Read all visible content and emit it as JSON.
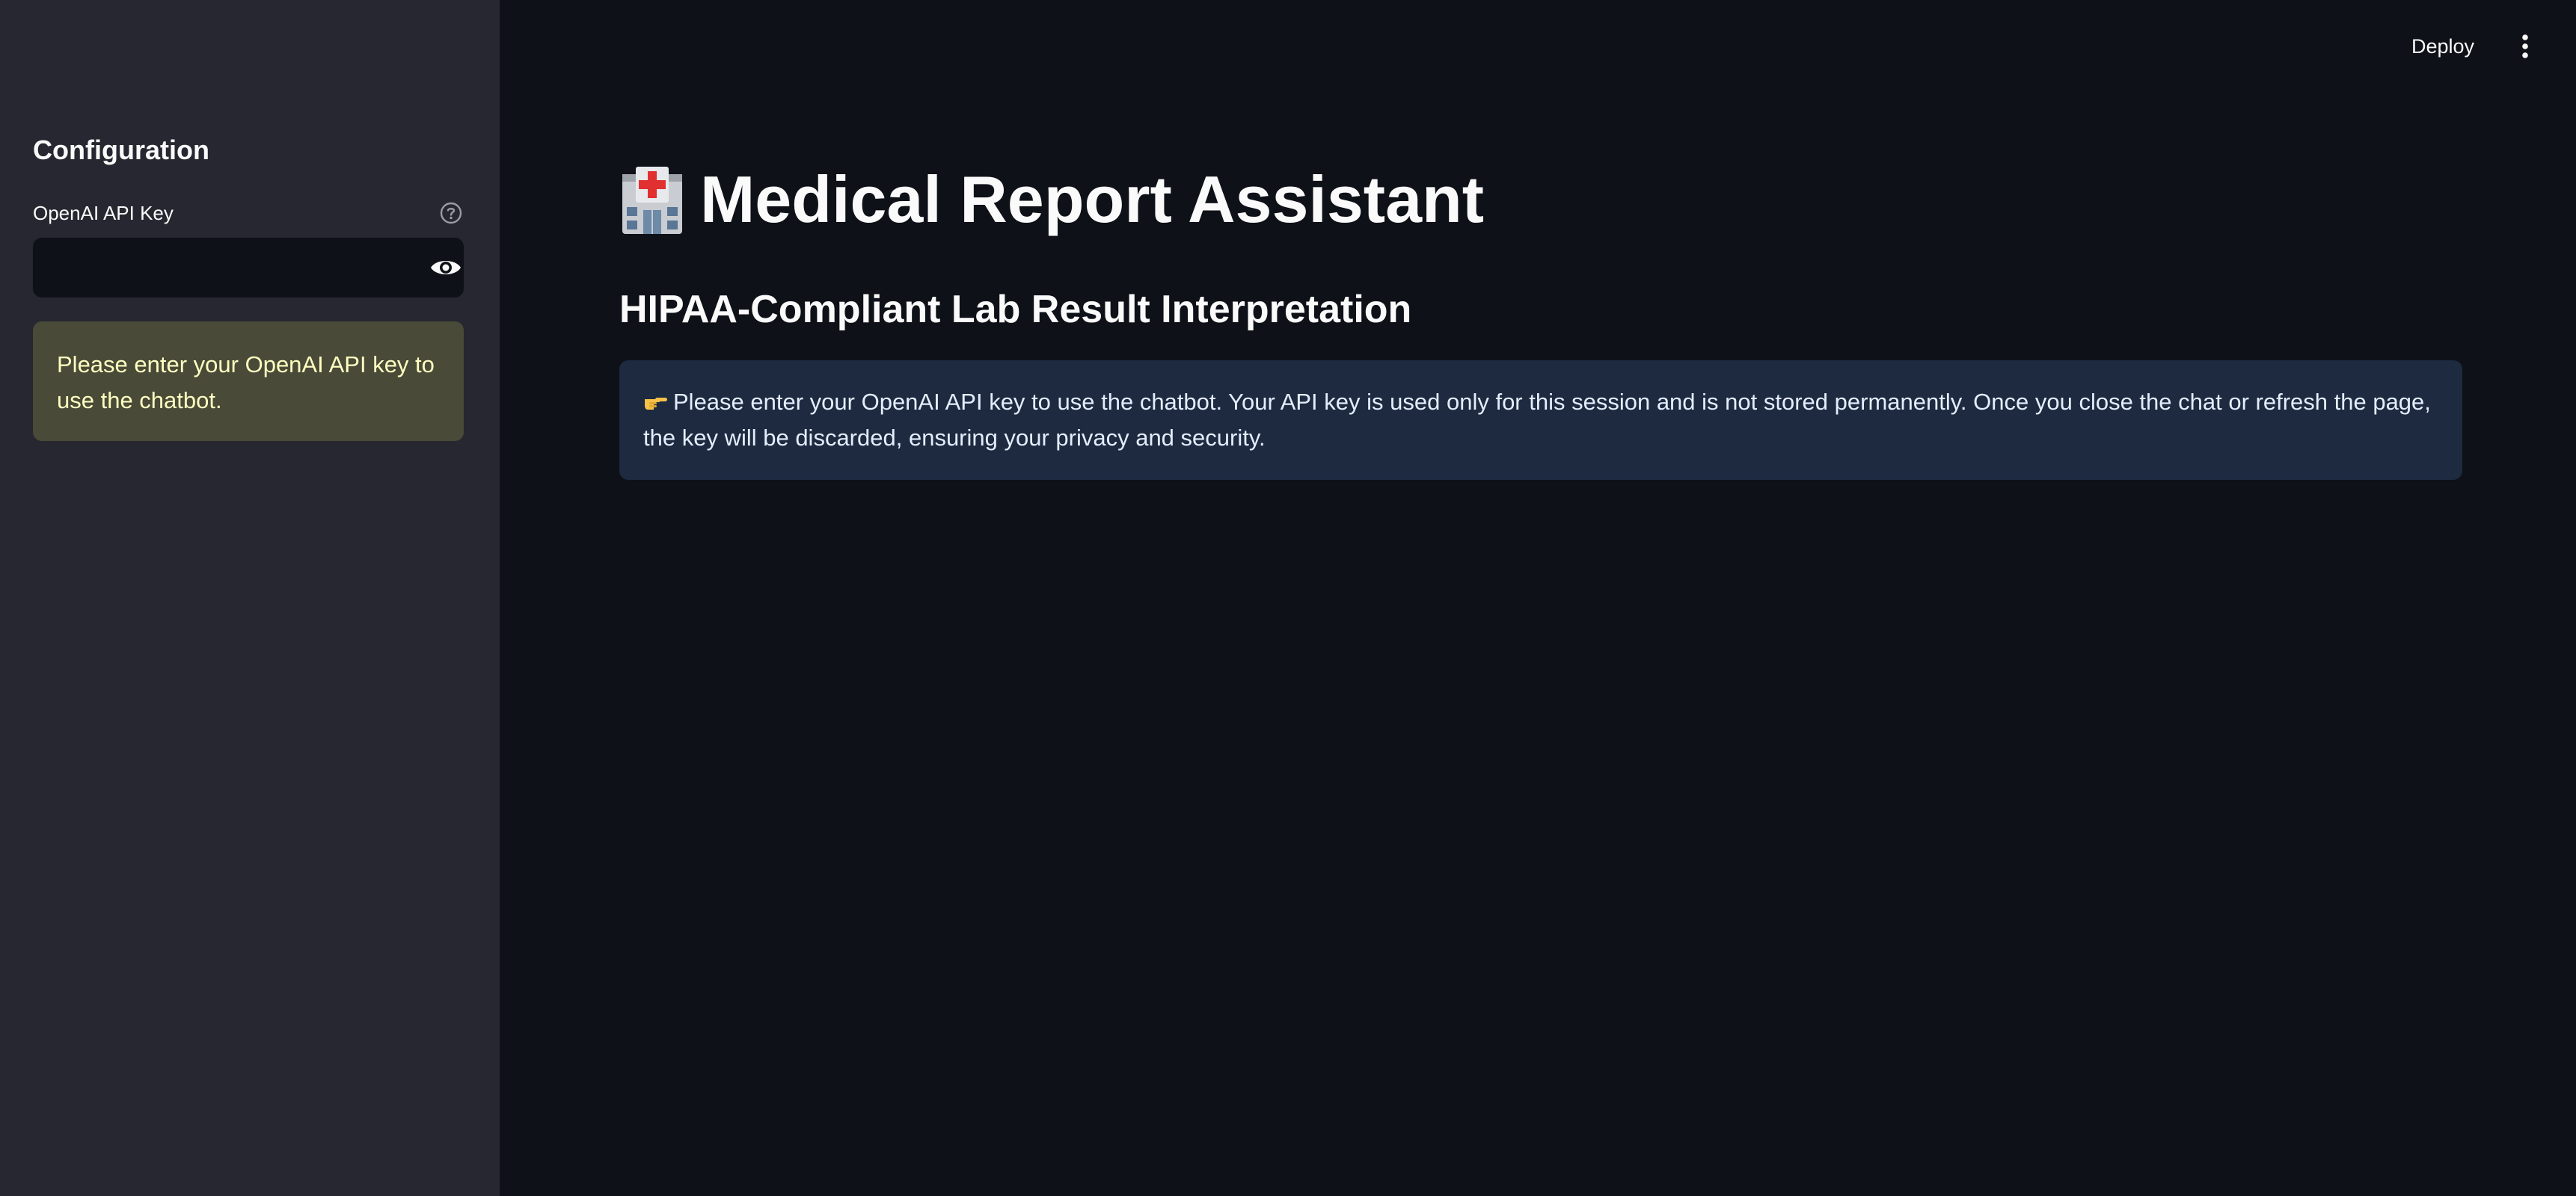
{
  "sidebar": {
    "title": "Configuration",
    "api_key": {
      "label": "OpenAI API Key",
      "value": "",
      "help_icon": "question-circle-icon",
      "visibility_icon": "eye-icon"
    },
    "warning": "Please enter your OpenAI API key to use the chatbot."
  },
  "toolbar": {
    "deploy_label": "Deploy",
    "menu_icon": "vertical-ellipsis-icon"
  },
  "main": {
    "title_icon": "hospital-icon",
    "title": "Medical Report Assistant",
    "subtitle": "HIPAA-Compliant Lab Result Interpretation",
    "info_icon": "pointing-hand-icon",
    "info": "Please enter your OpenAI API key to use the chatbot. Your API key is used only for this session and is not stored permanently. Once you close the chat or refresh the page, the key will be discarded, ensuring your privacy and security."
  },
  "colors": {
    "background": "#0e1117",
    "sidebar": "#262730",
    "warning_bg": "#4a4a38",
    "warning_text": "#ffffc2",
    "info_bg": "#1d2a40",
    "info_text": "#e3eefc"
  }
}
